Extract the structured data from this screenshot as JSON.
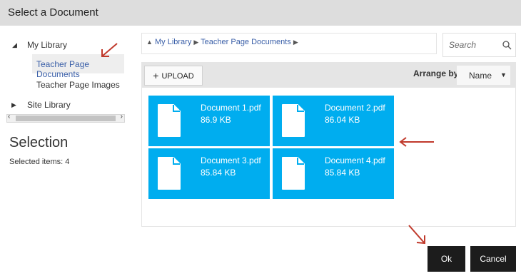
{
  "dialog": {
    "title": "Select a Document"
  },
  "tree": {
    "my_library": "My Library",
    "teacher_page_documents": "Teacher Page Documents",
    "teacher_page_images": "Teacher Page Images",
    "site_library": "Site Library"
  },
  "selection": {
    "title": "Selection",
    "count_text": "Selected items: 4"
  },
  "breadcrumb": {
    "root": "My Library",
    "folder": "Teacher Page Documents"
  },
  "search": {
    "placeholder": "Search"
  },
  "toolbar": {
    "upload_label": "UPLOAD",
    "arrange_label": "Arrange by:",
    "arrange_value": "Name"
  },
  "files": [
    {
      "name": "Document 1.pdf",
      "size": "86.9 KB"
    },
    {
      "name": "Document 2.pdf",
      "size": "86.04 KB"
    },
    {
      "name": "Document 3.pdf",
      "size": "85.84 KB"
    },
    {
      "name": "Document 4.pdf",
      "size": "85.84 KB"
    }
  ],
  "actions": {
    "ok": "Ok",
    "cancel": "Cancel"
  },
  "colors": {
    "tile": "#00adef",
    "annotation_arrow": "#c0392b",
    "button_dark": "#1c1c1c"
  }
}
